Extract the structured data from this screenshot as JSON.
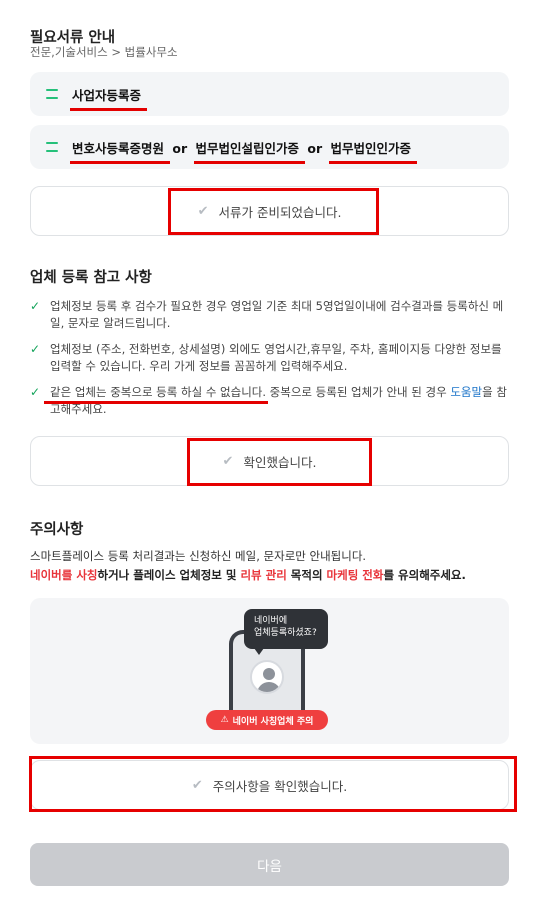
{
  "docs": {
    "title": "필요서류 안내",
    "category": "전문,기술서비스 > 법률사무소",
    "card1": "사업자등록증",
    "card2": {
      "part1": "변호사등록증명원",
      "or1": "or",
      "part2": "법무법인설립인가증",
      "or2": "or",
      "part3": "법무법인인가증"
    },
    "confirm": "서류가 준비되었습니다."
  },
  "reference": {
    "title": "업체 등록 참고 사항",
    "items": [
      "업체정보 등록 후 검수가 필요한 경우 영업일 기준 최대 5영업일이내에 검수결과를 등록하신 메일, 문자로 알려드립니다.",
      "업체정보 (주소, 전화번호, 상세설명) 외에도 영업시간,휴무일, 주차, 홈페이지등 다양한 정보를 입력할 수 있습니다. 우리 가게 정보를 꼼꼼하게 입력해주세요."
    ],
    "item3": {
      "emphasis": "같은 업체는 중복으로 등록 하실 수 없습니다.",
      "rest": " 중복으로 등록된 업체가 안내 된 경우 ",
      "link": "도움말",
      "tail": "을 참고해주세요."
    },
    "confirm": "확인했습니다."
  },
  "caution": {
    "title": "주의사항",
    "line1": "스마트플레이스 등록 처리결과는 신청하신 메일, 문자로만 안내됩니다.",
    "line2": {
      "r1": "네이버를 사칭",
      "t1": "하거나 플레이스 업체정보 및 ",
      "r2": "리뷰 관리",
      "t2": " 목적의 ",
      "r3": "마케팅 전화",
      "t3": "를 유의해주세요."
    },
    "bubble_line1": "네이버에",
    "bubble_line2": "업체등록하셨죠?",
    "warning_badge": "네이버 사칭업체 주의",
    "confirm": "주의사항을 확인했습니다."
  },
  "next_button": "다음",
  "colors": {
    "accent_green": "#13a35a",
    "red_text": "#e8343a",
    "link_blue": "#1a73c8",
    "annotation_red": "#e60000"
  }
}
